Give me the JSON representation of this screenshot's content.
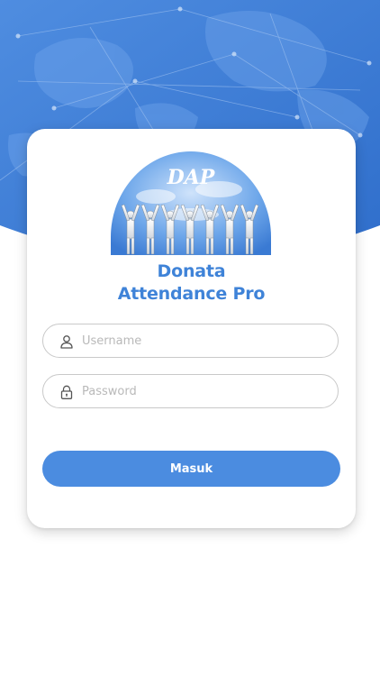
{
  "app": {
    "logo_text": "DAP",
    "name_line1": "Donata",
    "name_line2": "Attendance Pro"
  },
  "login": {
    "username_placeholder": "Username",
    "password_placeholder": "Password",
    "submit_label": "Masuk"
  },
  "icons": {
    "username": "user-icon",
    "password": "lock-icon"
  },
  "colors": {
    "primary": "#4b8ce0",
    "title": "#3f83d8",
    "header_bg": "#3b7bd6",
    "input_border": "#c9c9c9",
    "placeholder": "#b9b9b9"
  }
}
